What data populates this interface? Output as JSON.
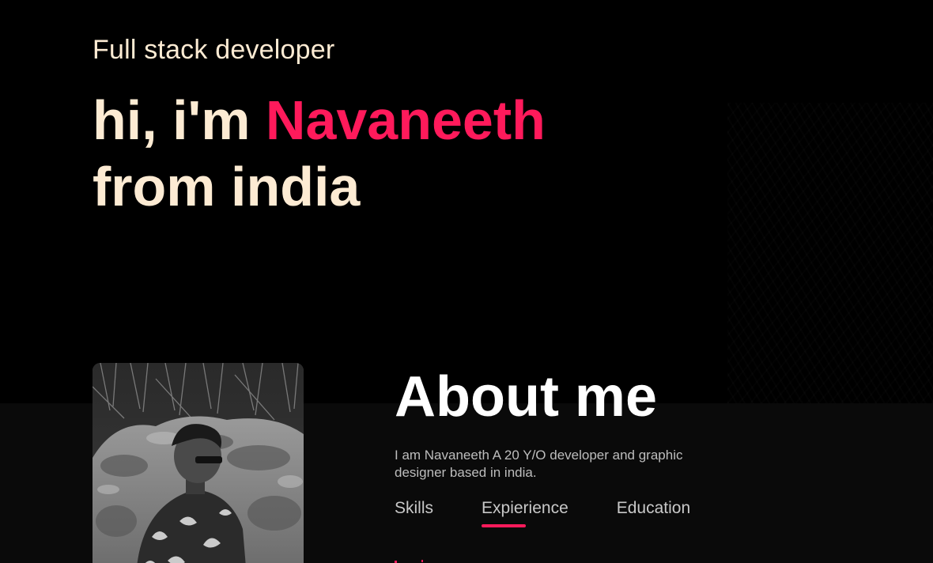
{
  "hero": {
    "subtitle": "Full stack developer",
    "greeting": "hi, i'm ",
    "name": "Navaneeth",
    "location": "from india"
  },
  "about": {
    "title": "About me",
    "description": "I am Navaneeth A 20 Y/O developer and graphic designer based in india.",
    "tabs": [
      {
        "label": "Skills",
        "active": false
      },
      {
        "label": "Expierience",
        "active": true
      },
      {
        "label": "Education",
        "active": false
      }
    ]
  },
  "colors": {
    "accent": "#ff1a5b",
    "heading": "#fdebd3",
    "background": "#000000",
    "section_background": "#0a0a0a"
  }
}
